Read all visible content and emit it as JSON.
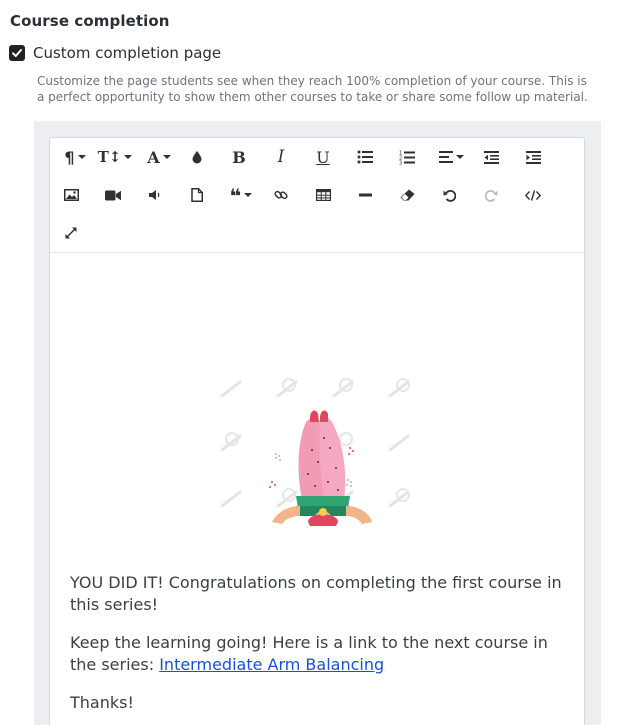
{
  "section": {
    "title": "Course completion"
  },
  "option": {
    "checked": true,
    "label": "Custom completion page",
    "help": "Customize the page students see when they reach 100% completion of your course. This is a perfect opportunity to show them other courses to take or share some follow up material."
  },
  "toolbar": {
    "row1": [
      "paragraph-format-icon",
      "font-size-icon",
      "text-color-icon",
      "background-color-icon",
      "bold-icon",
      "italic-icon",
      "underline-icon",
      "bullet-list-icon",
      "numbered-list-icon",
      "align-icon",
      "outdent-icon",
      "indent-icon"
    ],
    "row2": [
      "insert-image-icon",
      "insert-video-icon",
      "insert-audio-icon",
      "insert-file-icon",
      "quote-icon",
      "link-icon",
      "table-icon",
      "horizontal-line-icon",
      "clear-format-icon",
      "undo-icon",
      "redo-icon",
      "code-view-icon"
    ],
    "row3": [
      "fullscreen-icon"
    ]
  },
  "content": {
    "paragraph1": "YOU DID IT! Congratulations on completing the first course in this series!",
    "paragraph2_text": "Keep the learning going! Here is a link to the next course in the series: ",
    "paragraph2_link": "Intermediate Arm Balancing",
    "paragraph3": "Thanks!"
  },
  "colors": {
    "accent": "#1a4fd6",
    "checkbox": "#1f2328",
    "editor_bg": "#eceef1"
  }
}
